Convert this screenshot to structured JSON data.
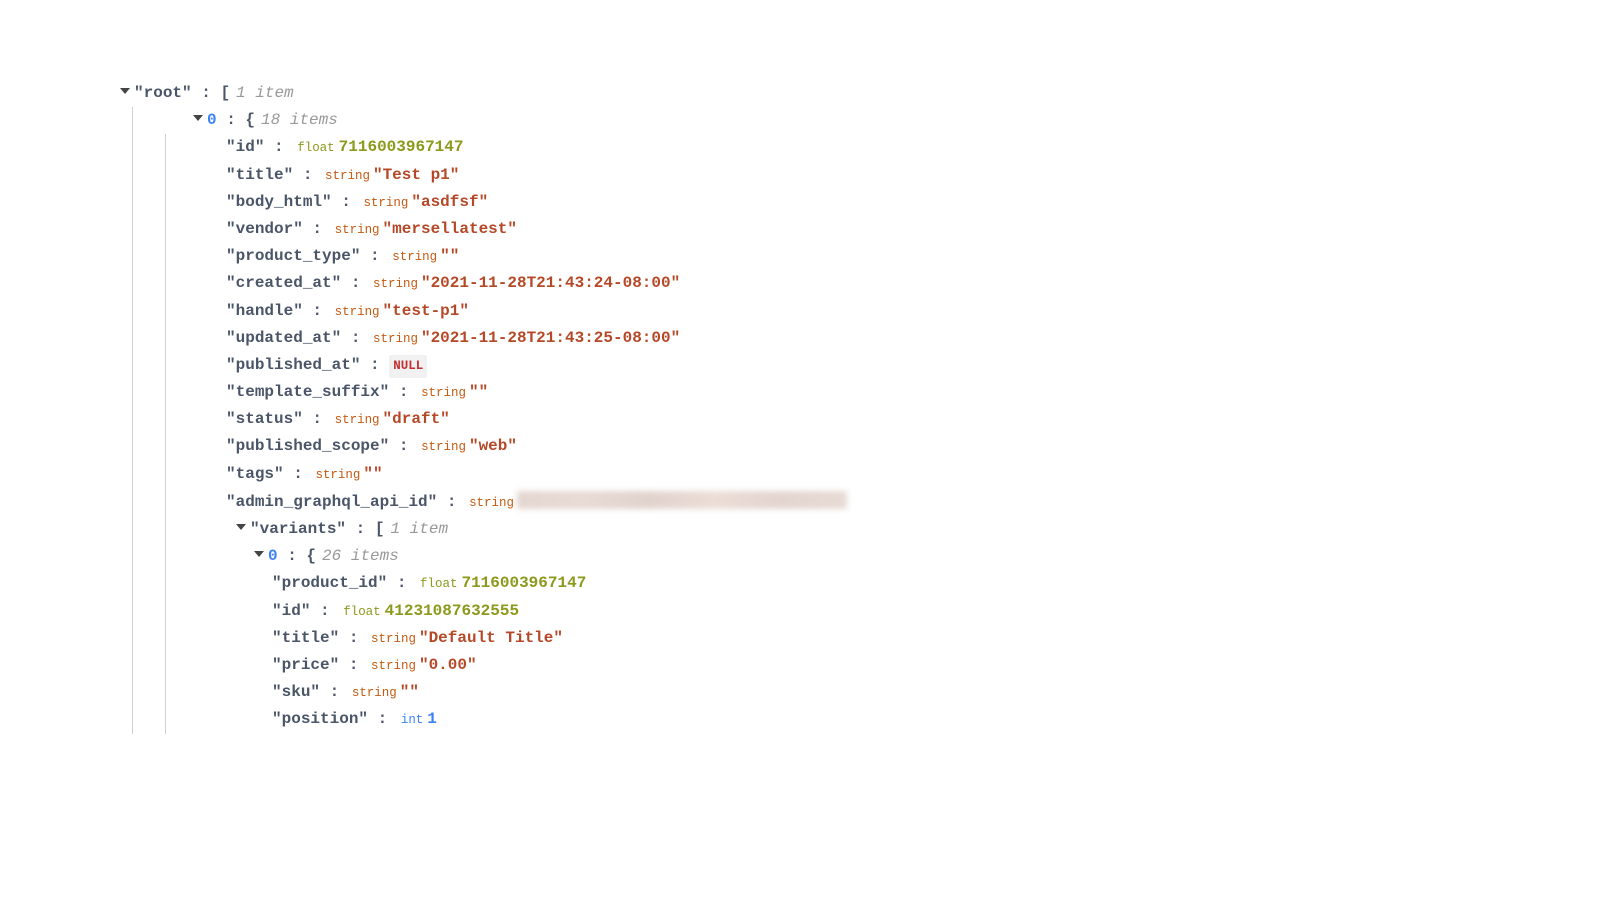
{
  "root": {
    "label": "root",
    "count_text": "1 item",
    "items": [
      {
        "idx": "0",
        "count_text": "18 items",
        "fields": {
          "id": {
            "type": "float",
            "value": "7116003967147"
          },
          "title": {
            "type": "string",
            "value": "Test p1"
          },
          "body_html": {
            "type": "string",
            "value": "asdfsf"
          },
          "vendor": {
            "type": "string",
            "value": "mersellatest"
          },
          "product_type": {
            "type": "string",
            "value": ""
          },
          "created_at": {
            "type": "string",
            "value": "2021-11-28T21:43:24-08:00"
          },
          "handle": {
            "type": "string",
            "value": "test-p1"
          },
          "updated_at": {
            "type": "string",
            "value": "2021-11-28T21:43:25-08:00"
          },
          "published_at": {
            "type": "null",
            "value": "NULL"
          },
          "template_suffix": {
            "type": "string",
            "value": ""
          },
          "status": {
            "type": "string",
            "value": "draft"
          },
          "published_scope": {
            "type": "string",
            "value": "web"
          },
          "tags": {
            "type": "string",
            "value": ""
          },
          "admin_graphql_api_id": {
            "type": "string",
            "redacted": true
          }
        },
        "variants": {
          "label": "variants",
          "count_text": "1 item",
          "items": [
            {
              "idx": "0",
              "count_text": "26 items",
              "fields": {
                "product_id": {
                  "type": "float",
                  "value": "7116003967147"
                },
                "id": {
                  "type": "float",
                  "value": "41231087632555"
                },
                "title": {
                  "type": "string",
                  "value": "Default Title"
                },
                "price": {
                  "type": "string",
                  "value": "0.00"
                },
                "sku": {
                  "type": "string",
                  "value": ""
                },
                "position": {
                  "type": "int",
                  "value": "1"
                }
              }
            }
          ]
        }
      }
    ]
  },
  "type_labels": {
    "float": "float",
    "string": "string",
    "int": "int"
  }
}
